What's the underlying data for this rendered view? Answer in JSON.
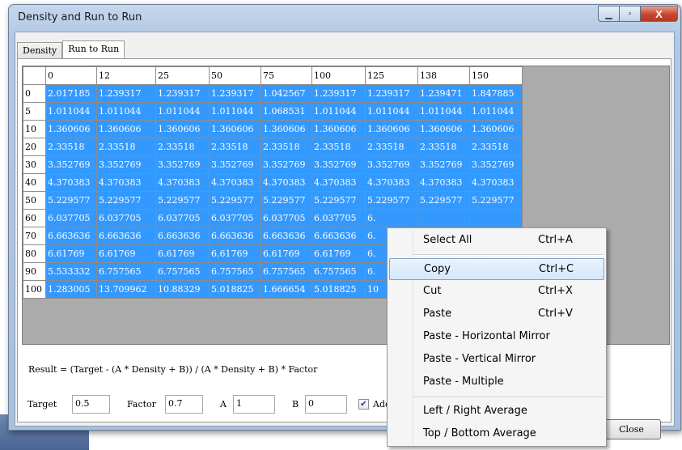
{
  "window": {
    "title": "Density and Run to Run",
    "caption": {
      "minimize": "▁",
      "maximize": "▫",
      "close": "X"
    }
  },
  "tabs": [
    {
      "label": "Density",
      "active": false
    },
    {
      "label": "Run to Run",
      "active": true
    }
  ],
  "grid": {
    "columns": [
      "0",
      "12",
      "25",
      "50",
      "75",
      "100",
      "125",
      "138",
      "150"
    ],
    "rows": [
      {
        "h": "0",
        "cells": [
          "2.017185",
          "1.239317",
          "1.239317",
          "1.239317",
          "1.042567",
          "1.239317",
          "1.239317",
          "1.239471",
          "1.847885"
        ]
      },
      {
        "h": "5",
        "cells": [
          "1.011044",
          "1.011044",
          "1.011044",
          "1.011044",
          "1.068531",
          "1.011044",
          "1.011044",
          "1.011044",
          "1.011044"
        ]
      },
      {
        "h": "10",
        "cells": [
          "1.360606",
          "1.360606",
          "1.360606",
          "1.360606",
          "1.360606",
          "1.360606",
          "1.360606",
          "1.360606",
          "1.360606"
        ]
      },
      {
        "h": "20",
        "cells": [
          "2.33518",
          "2.33518",
          "2.33518",
          "2.33518",
          "2.33518",
          "2.33518",
          "2.33518",
          "2.33518",
          "2.33518"
        ]
      },
      {
        "h": "30",
        "cells": [
          "3.352769",
          "3.352769",
          "3.352769",
          "3.352769",
          "3.352769",
          "3.352769",
          "3.352769",
          "3.352769",
          "3.352769"
        ]
      },
      {
        "h": "40",
        "cells": [
          "4.370383",
          "4.370383",
          "4.370383",
          "4.370383",
          "4.370383",
          "4.370383",
          "4.370383",
          "4.370383",
          "4.370383"
        ]
      },
      {
        "h": "50",
        "cells": [
          "5.229577",
          "5.229577",
          "5.229577",
          "5.229577",
          "5.229577",
          "5.229577",
          "5.229577",
          "5.229577",
          "5.229577"
        ]
      },
      {
        "h": "60",
        "cells": [
          "6.037705",
          "6.037705",
          "6.037705",
          "6.037705",
          "6.037705",
          "6.037705",
          "6.",
          "",
          ""
        ]
      },
      {
        "h": "70",
        "cells": [
          "6.663636",
          "6.663636",
          "6.663636",
          "6.663636",
          "6.663636",
          "6.663636",
          "6.",
          "",
          ""
        ]
      },
      {
        "h": "80",
        "cells": [
          "6.61769",
          "6.61769",
          "6.61769",
          "6.61769",
          "6.61769",
          "6.61769",
          "6.",
          "",
          ""
        ]
      },
      {
        "h": "90",
        "cells": [
          "5.533332",
          "6.757565",
          "6.757565",
          "6.757565",
          "6.757565",
          "6.757565",
          "6.",
          "",
          ""
        ]
      },
      {
        "h": "100",
        "cells": [
          "1.283005",
          "13.709962",
          "10.88329",
          "5.018825",
          "1.666654",
          "5.018825",
          "10",
          "",
          ""
        ]
      }
    ]
  },
  "formula": "Result = (Target - (A * Density + B)) / (A * Density + B) * Factor",
  "fields": {
    "target": {
      "label": "Target",
      "value": "0.5"
    },
    "factor": {
      "label": "Factor",
      "value": "0.7"
    },
    "a": {
      "label": "A",
      "value": "1"
    },
    "b": {
      "label": "B",
      "value": "0"
    }
  },
  "checkbox": {
    "label": "Add",
    "checked": true
  },
  "close_label": "Close",
  "context_menu": {
    "items": [
      {
        "label": "Select All",
        "shortcut": "Ctrl+A"
      },
      {
        "label": "Copy",
        "shortcut": "Ctrl+C",
        "highlighted": true
      },
      {
        "label": "Cut",
        "shortcut": "Ctrl+X"
      },
      {
        "label": "Paste",
        "shortcut": "Ctrl+V"
      },
      {
        "label": "Paste - Horizontal Mirror",
        "shortcut": ""
      },
      {
        "label": "Paste - Vertical Mirror",
        "shortcut": ""
      },
      {
        "label": "Paste - Multiple",
        "shortcut": ""
      },
      {
        "label": "Left / Right Average",
        "shortcut": ""
      },
      {
        "label": "Top / Bottom Average",
        "shortcut": ""
      }
    ]
  },
  "colors": {
    "selection": "#3399ff",
    "grid_background": "#ababab",
    "menu_highlight": "#d4e7fb"
  }
}
